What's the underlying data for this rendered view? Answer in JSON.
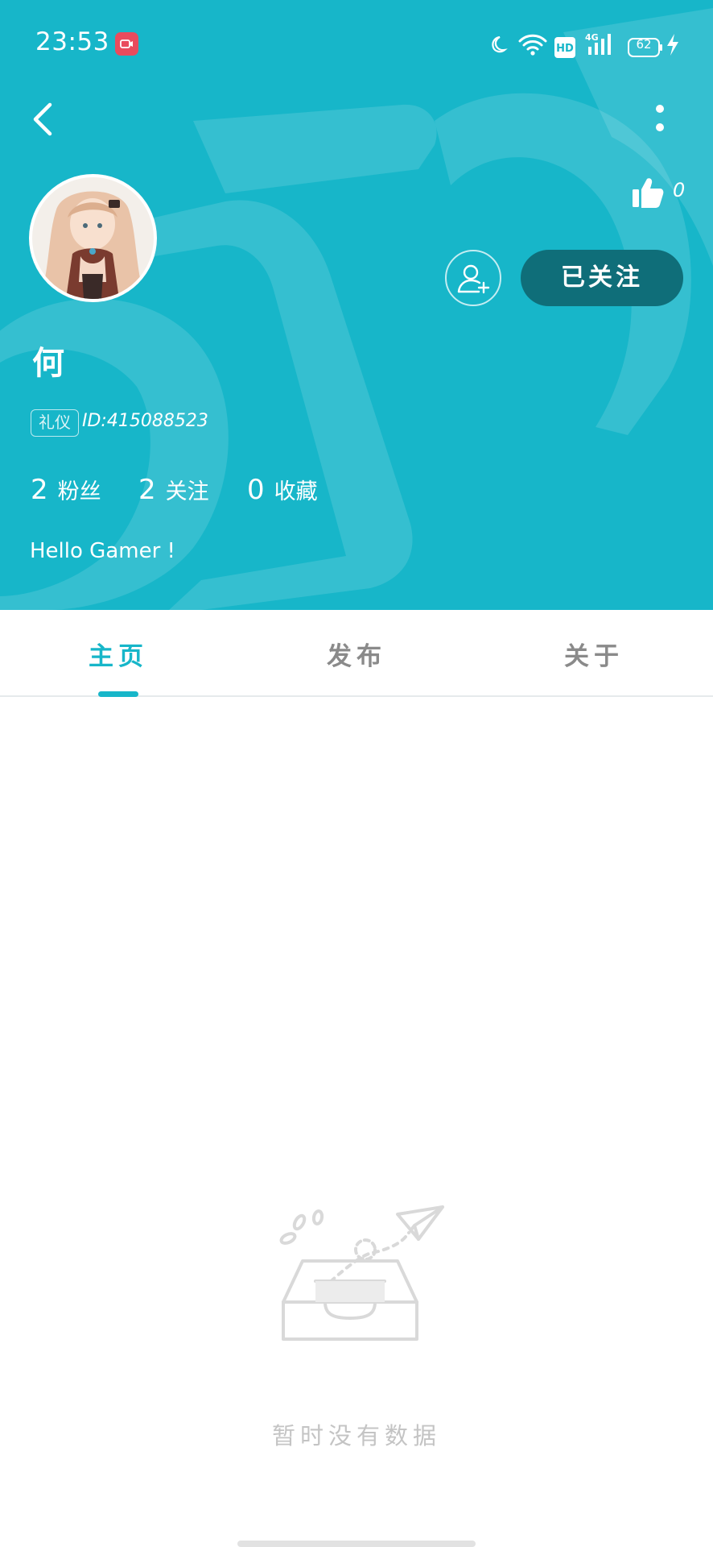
{
  "status_bar": {
    "time": "23:53",
    "battery": "62",
    "icons": [
      "screen-record-icon",
      "moon-icon",
      "wifi-icon",
      "hd-icon",
      "4g-signal-icon",
      "battery-icon",
      "charging-icon"
    ]
  },
  "header": {
    "back_icon": "chevron-left-icon",
    "more_icon": "vertical-dots-icon",
    "like_icon": "thumbs-up-icon",
    "like_count": "0",
    "follow_button": "已关注",
    "add_friend_icon": "add-user-icon"
  },
  "profile": {
    "username": "何",
    "tag": "礼仪",
    "id": "ID:415088523",
    "stats": [
      {
        "value": "2",
        "label": "粉丝"
      },
      {
        "value": "2",
        "label": "关注"
      },
      {
        "value": "0",
        "label": "收藏"
      }
    ],
    "bio": "Hello Gamer !"
  },
  "tabs": {
    "items": [
      {
        "label": "主页",
        "active": true
      },
      {
        "label": "发布",
        "active": false
      },
      {
        "label": "关于",
        "active": false
      }
    ]
  },
  "empty_state": {
    "icon": "empty-inbox-paper-plane-icon",
    "text": "暂时没有数据"
  },
  "colors": {
    "primary": "#17b6c9",
    "follow_button_bg": "#0f6e79",
    "tab_inactive": "#8a8a8a",
    "empty_text": "#c4c4c4"
  }
}
